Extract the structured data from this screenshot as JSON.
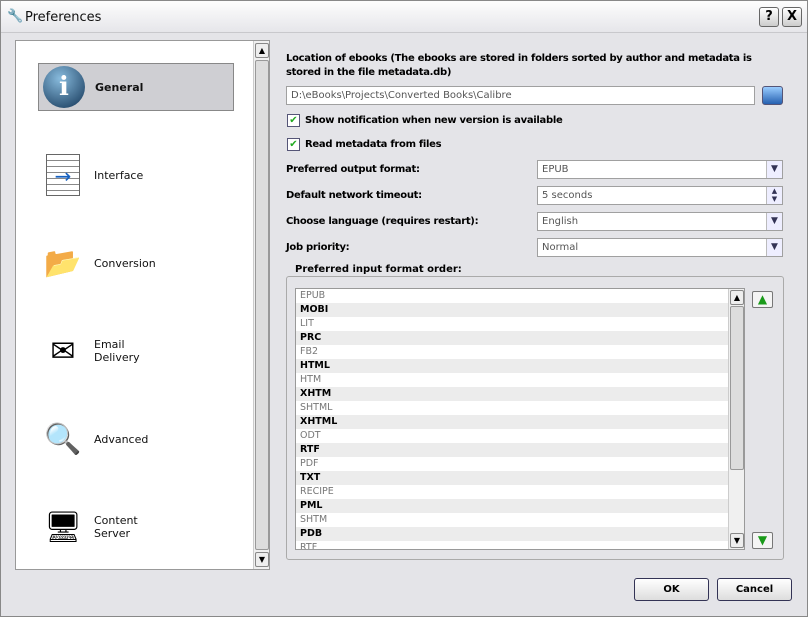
{
  "window": {
    "title": "Preferences",
    "help": "?",
    "close": "X"
  },
  "sidebar": {
    "items": [
      {
        "label": "General",
        "icon": "info-icon",
        "selected": true
      },
      {
        "label": "Interface",
        "icon": "interface-icon"
      },
      {
        "label": "Conversion",
        "icon": "conversion-icon"
      },
      {
        "label": "Email\nDelivery",
        "icon": "envelope-icon"
      },
      {
        "label": "Advanced",
        "icon": "magnifier-icon"
      },
      {
        "label": "Content\nServer",
        "icon": "server-icon"
      }
    ]
  },
  "general": {
    "location_label": "Location of ebooks (The ebooks are stored in folders sorted by author and metadata is stored in the file metadata.db)",
    "location_value": "D:\\eBooks\\Projects\\Converted Books\\Calibre",
    "show_notification": {
      "label": "Show notification when new version is available",
      "checked": true
    },
    "read_metadata": {
      "label": "Read metadata from files",
      "checked": true
    },
    "output_format": {
      "label": "Preferred output format:",
      "value": "EPUB"
    },
    "timeout": {
      "label": "Default network timeout:",
      "value": "5 seconds"
    },
    "language": {
      "label": "Choose language (requires restart):",
      "value": "English"
    },
    "priority": {
      "label": "Job priority:",
      "value": "Normal"
    },
    "input_order": {
      "label": "Preferred input format order:",
      "formats": [
        "EPUB",
        "MOBI",
        "LIT",
        "PRC",
        "FB2",
        "HTML",
        "HTM",
        "XHTM",
        "SHTML",
        "XHTML",
        "ODT",
        "RTF",
        "PDF",
        "TXT",
        "RECIPE",
        "PML",
        "SHTM",
        "PDB",
        "RTF"
      ]
    }
  },
  "buttons": {
    "ok": "OK",
    "cancel": "Cancel"
  }
}
